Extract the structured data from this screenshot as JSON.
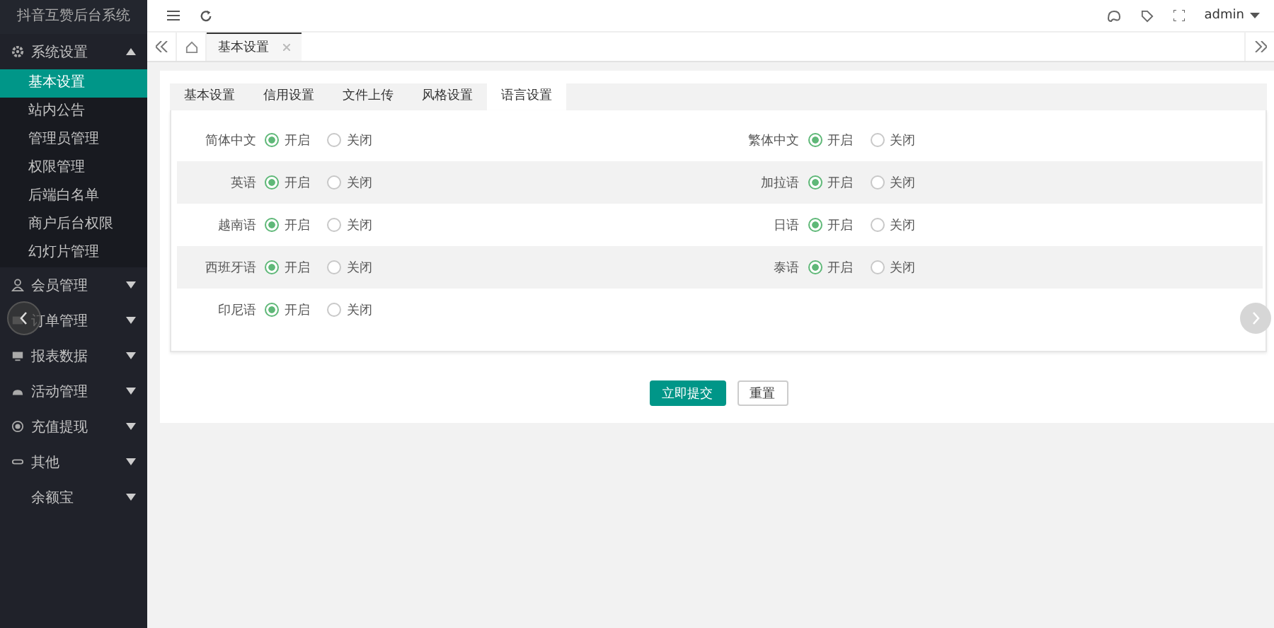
{
  "sidebar": {
    "title": "抖音互赞后台系统",
    "groups": [
      {
        "label": "系统设置",
        "expanded": true,
        "children": [
          {
            "label": "基本设置",
            "selected": true
          },
          {
            "label": "站内公告",
            "selected": false
          },
          {
            "label": "管理员管理",
            "selected": false
          },
          {
            "label": "权限管理",
            "selected": false
          },
          {
            "label": "后端白名单",
            "selected": false
          },
          {
            "label": "商户后台权限",
            "selected": false
          },
          {
            "label": "幻灯片管理",
            "selected": false
          }
        ]
      },
      {
        "label": "会员管理",
        "expanded": false
      },
      {
        "label": "订单管理",
        "expanded": false
      },
      {
        "label": "报表数据",
        "expanded": false
      },
      {
        "label": "活动管理",
        "expanded": false
      },
      {
        "label": "充值提现",
        "expanded": false
      },
      {
        "label": "其他",
        "expanded": false
      },
      {
        "label": "余额宝",
        "expanded": false
      }
    ]
  },
  "header": {
    "user": "admin"
  },
  "page_tabs": [
    {
      "label": "基本设置",
      "selected": true
    }
  ],
  "settings_tabs": [
    {
      "label": "基本设置",
      "selected": false
    },
    {
      "label": "信用设置",
      "selected": false
    },
    {
      "label": "文件上传",
      "selected": false
    },
    {
      "label": "风格设置",
      "selected": false
    },
    {
      "label": "语言设置",
      "selected": true
    }
  ],
  "languages": [
    {
      "label": "简体中文",
      "options": [
        {
          "label": "开启",
          "selected": true
        },
        {
          "label": "关闭",
          "selected": false
        }
      ]
    },
    {
      "label": "繁体中文",
      "options": [
        {
          "label": "开启",
          "selected": true
        },
        {
          "label": "关闭",
          "selected": false
        }
      ]
    },
    {
      "label": "英语",
      "options": [
        {
          "label": "开启",
          "selected": true
        },
        {
          "label": "关闭",
          "selected": false
        }
      ]
    },
    {
      "label": "加拉语",
      "options": [
        {
          "label": "开启",
          "selected": true
        },
        {
          "label": "关闭",
          "selected": false
        }
      ]
    },
    {
      "label": "越南语",
      "options": [
        {
          "label": "开启",
          "selected": true
        },
        {
          "label": "关闭",
          "selected": false
        }
      ]
    },
    {
      "label": "日语",
      "options": [
        {
          "label": "开启",
          "selected": true
        },
        {
          "label": "关闭",
          "selected": false
        }
      ]
    },
    {
      "label": "西班牙语",
      "options": [
        {
          "label": "开启",
          "selected": true
        },
        {
          "label": "关闭",
          "selected": false
        }
      ]
    },
    {
      "label": "泰语",
      "options": [
        {
          "label": "开启",
          "selected": true
        },
        {
          "label": "关闭",
          "selected": false
        }
      ]
    },
    {
      "label": "印尼语",
      "options": [
        {
          "label": "开启",
          "selected": true
        },
        {
          "label": "关闭",
          "selected": false
        }
      ]
    }
  ],
  "buttons": [
    {
      "label": "立即提交",
      "kind": "primary"
    },
    {
      "label": "重置",
      "kind": "plain"
    }
  ]
}
